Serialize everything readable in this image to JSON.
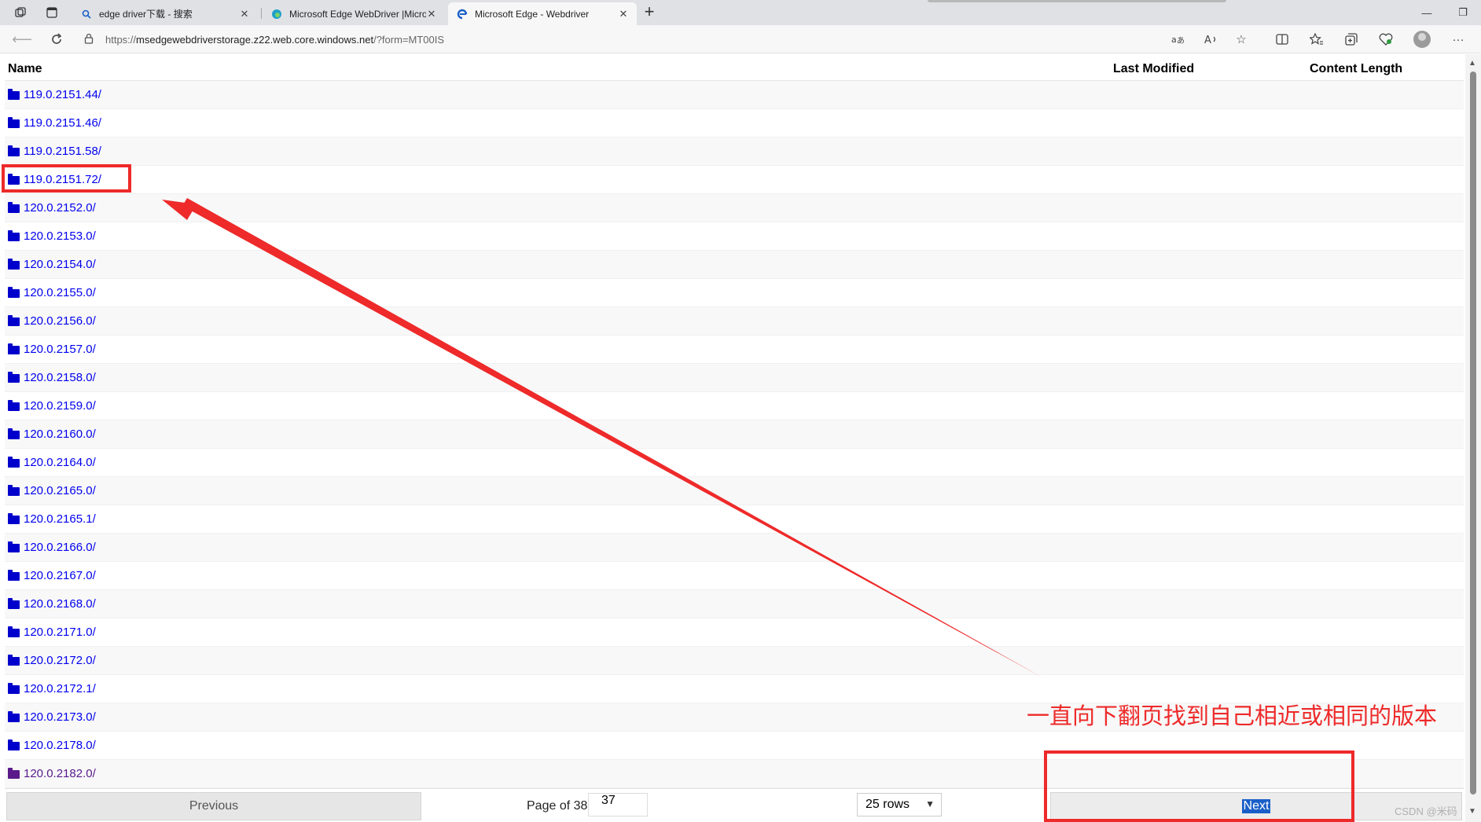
{
  "browser": {
    "tabs": [
      {
        "title": "edge driver下载 - 搜索",
        "icon": "search-icon"
      },
      {
        "title": "Microsoft Edge WebDriver |Micro",
        "icon": "edge-icon"
      },
      {
        "title": "Microsoft Edge - Webdriver",
        "icon": "edge-icon"
      }
    ],
    "active_tab": 2,
    "url_prefix": "https://",
    "url_host": "msedgewebdriverstorage.z22.web.core.windows.net",
    "url_path": "/?form=MT00IS"
  },
  "table": {
    "headers": {
      "name": "Name",
      "last_modified": "Last Modified",
      "content_length": "Content Length"
    },
    "rows": [
      "119.0.2151.44/",
      "119.0.2151.46/",
      "119.0.2151.58/",
      "119.0.2151.72/",
      "120.0.2152.0/",
      "120.0.2153.0/",
      "120.0.2154.0/",
      "120.0.2155.0/",
      "120.0.2156.0/",
      "120.0.2157.0/",
      "120.0.2158.0/",
      "120.0.2159.0/",
      "120.0.2160.0/",
      "120.0.2164.0/",
      "120.0.2165.0/",
      "120.0.2165.1/",
      "120.0.2166.0/",
      "120.0.2167.0/",
      "120.0.2168.0/",
      "120.0.2171.0/",
      "120.0.2172.0/",
      "120.0.2172.1/",
      "120.0.2173.0/",
      "120.0.2178.0/",
      "120.0.2182.0/"
    ],
    "visited_row": 24
  },
  "pager": {
    "previous_label": "Previous",
    "page_label": "Page of 38",
    "page_value": "37",
    "rows_label": "25 rows",
    "next_label": "Next"
  },
  "annotation": {
    "text": "一直向下翻页找到自己相近或相同的版本",
    "color": "#ee2a2a"
  },
  "watermark": "CSDN @米码"
}
